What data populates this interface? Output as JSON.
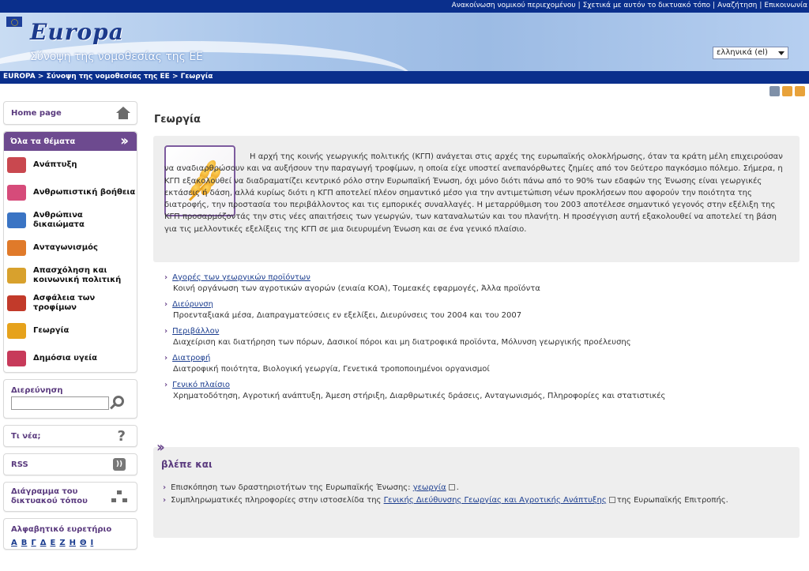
{
  "topbar": {
    "links": [
      "Ανακοίνωση νομικού περιεχομένου",
      "Σχετικά με αυτόν το δικτυακό τόπο",
      "Αναζήτηση",
      "Επικοινωνία"
    ]
  },
  "banner": {
    "logo": "Europa",
    "subtitle": "Σύνοψη της νομοθεσίας της ΕΕ",
    "language": "ελληνικά (el)"
  },
  "breadcrumb": "EUROPA > Σύνοψη της νομοθεσίας της ΕΕ > Γεωργία",
  "sidebar": {
    "home": "Home page",
    "themes_title": "Όλα τα θέματα",
    "themes": [
      {
        "label": "Ανάπτυξη",
        "icon": "development-icon",
        "color": "#c9484f"
      },
      {
        "label": "Ανθρωπιστική βοήθεια",
        "icon": "humanitarian-aid-icon",
        "color": "#d64b7a"
      },
      {
        "label": "Ανθρώπινα δικαιώματα",
        "icon": "human-rights-icon",
        "color": "#3a74c4"
      },
      {
        "label": "Ανταγωνισμός",
        "icon": "competition-icon",
        "color": "#e07a2a"
      },
      {
        "label": "Απασχόληση και κοινωνική πολιτική",
        "icon": "employment-icon",
        "color": "#d8a12d"
      },
      {
        "label": "Ασφάλεια των τροφίμων",
        "icon": "food-safety-icon",
        "color": "#c23a2a"
      },
      {
        "label": "Γεωργία",
        "icon": "agriculture-icon",
        "color": "#e6a21c"
      },
      {
        "label": "Δημόσια υγεία",
        "icon": "public-health-icon",
        "color": "#c73a5a"
      }
    ],
    "search_title": "Διερεύνηση",
    "news": "Τι νέα;",
    "rss": "RSS",
    "sitemap": "Διάγραμμα του δικτυακού τόπου",
    "alpha_title": "Αλφαβητικό ευρετήριο",
    "alpha_letters": [
      "Α",
      "Β",
      "Γ",
      "Δ",
      "Ε",
      "Ζ",
      "Η",
      "Θ",
      "Ι"
    ]
  },
  "main": {
    "title": "Γεωργία",
    "intro": "Η αρχή της κοινής γεωργικής πολιτικής (ΚΓΠ) ανάγεται στις αρχές της ευρωπαϊκής ολοκλήρωσης, όταν τα κράτη μέλη επιχειρούσαν να αναδιαρθρώσουν και να αυξήσουν την παραγωγή τροφίμων, η οποία είχε υποστεί ανεπανόρθωτες ζημίες από τον δεύτερο παγκόσμιο πόλεμο. Σήμερα, η ΚΓΠ εξακολουθεί να διαδραματίζει κεντρικό ρόλο στην Ευρωπαϊκή Ένωση, όχι μόνο διότι πάνω από το 90% των εδαφών της Ένωσης είναι γεωργικές εκτάσεις ή δάση, αλλά κυρίως διότι η ΚΓΠ αποτελεί πλέον σημαντικό μέσο για την αντιμετώπιση νέων προκλήσεων που αφορούν την ποιότητα της διατροφής, την προστασία του περιβάλλοντος και τις εμπορικές συναλλαγές. Η μεταρρύθμιση του 2003 αποτέλεσε σημαντικό γεγονός στην εξέλιξη της ΚΓΠ προσαρμόζοντάς την στις νέες απαιτήσεις των γεωργών, των καταναλωτών και του πλανήτη. Η προσέγγιση αυτή εξακολουθεί να αποτελεί τη βάση για τις μελλοντικές εξελίξεις της ΚΓΠ σε μια διευρυμένη Ένωση και σε ένα γενικό πλαίσιο.",
    "sections": [
      {
        "title": "Αγορές των γεωργικών προϊόντων",
        "desc": "Κοινή οργάνωση των αγροτικών αγορών (ενιαία ΚΟΑ), Τομεακές εφαρμογές, Άλλα προϊόντα"
      },
      {
        "title": "Διεύρυνση",
        "desc": "Προενταξιακά μέσα, Διαπραγματεύσεις εν εξελίξει, Διευρύνσεις του 2004 και του 2007"
      },
      {
        "title": "Περιβάλλον",
        "desc": "Διαχείριση και διατήρηση των πόρων, Δασικοί πόροι και μη διατροφικά προϊόντα, Μόλυνση γεωργικής προέλευσης"
      },
      {
        "title": "Διατροφή",
        "desc": "Διατροφική ποιότητα, Βιολογική γεωργία, Γενετικά τροποποιημένοι οργανισμοί"
      },
      {
        "title": "Γενικό πλαίσιο",
        "desc": "Χρηματοδότηση, Αγροτική ανάπτυξη, Άμεση στήριξη, Διαρθρωτικές δράσεις, Ανταγωνισμός, Πληροφορίες και στατιστικές"
      }
    ],
    "see_also": {
      "title": "βλέπε και",
      "line1_prefix": "Επισκόπηση των δραστηριοτήτων της Ευρωπαϊκής Ένωσης:",
      "line1_link": "γεωργία",
      "line1_suffix": ".",
      "line2_prefix": "Συμπληρωματικές πληροφορίες στην ιστοσελίδα της",
      "line2_link": "Γενικής Διεύθυνσης Γεωργίας και Αγροτικής Ανάπτυξης",
      "line2_suffix": "της Ευρωπαϊκής Επιτροπής."
    }
  }
}
